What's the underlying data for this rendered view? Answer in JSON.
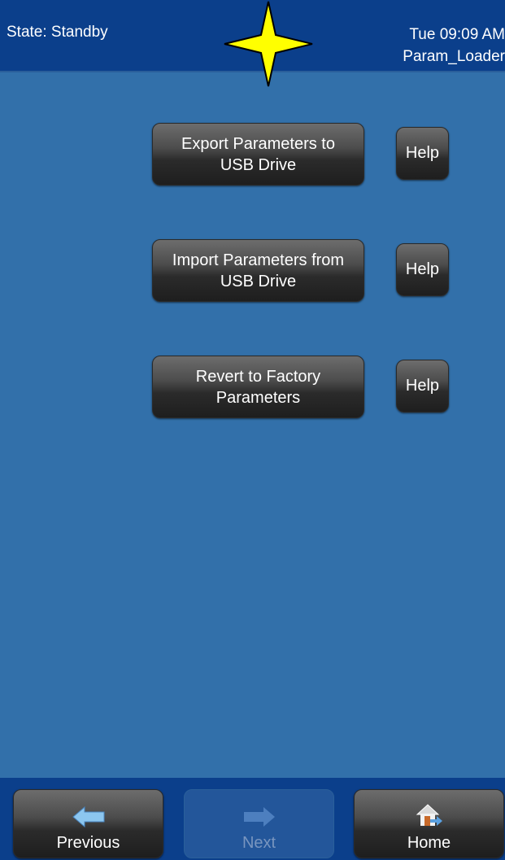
{
  "header": {
    "state": "State: Standby",
    "datetime": "Tue 09:09 AM",
    "screen_name": "Param_Loader"
  },
  "actions": [
    {
      "label": "Export Parameters to\nUSB Drive",
      "help_label": "Help"
    },
    {
      "label": "Import Parameters from\nUSB Drive",
      "help_label": "Help"
    },
    {
      "label": "Revert to Factory\nParameters",
      "help_label": "Help"
    }
  ],
  "nav": {
    "previous_label": "Previous",
    "next_label": "Next",
    "home_label": "Home"
  },
  "colors": {
    "background": "#3270aa",
    "bar": "#0b3f8b",
    "button_dark": "#2b2b2b",
    "star": "#ffff00",
    "arrow": "#8cc6ef",
    "arrow_disabled": "#4d7fbf"
  }
}
